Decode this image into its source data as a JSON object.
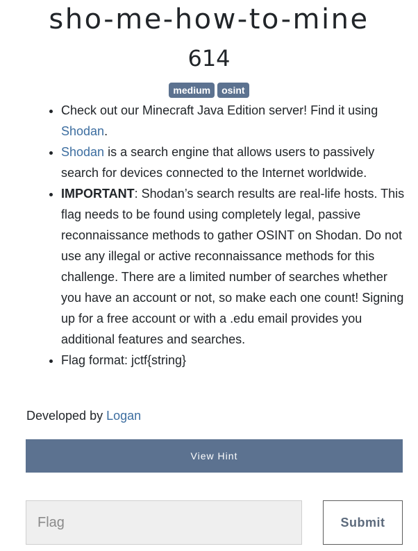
{
  "challenge": {
    "title": "sho-me-how-to-mine",
    "points": "614",
    "tags": [
      "medium",
      "osint"
    ]
  },
  "description": {
    "item1": {
      "text_before": "Check out our Minecraft Java Edition server! Find it using ",
      "link": "Shodan",
      "text_after": "."
    },
    "item2": {
      "link": "Shodan",
      "text_after": " is a search engine that allows users to passively search for devices connected to the Internet worldwide."
    },
    "item3": {
      "bold": "IMPORTANT",
      "text_after": ": Shodan’s search results are real-life hosts. This flag needs to be found using completely legal, passive reconnaissance methods to gather OSINT on Shodan. Do not use any illegal or active reconnaissance methods for this challenge. There are a limited number of searches whether you have an account or not, so make each one count! Signing up for a free account or with a .edu email provides you additional features and searches."
    },
    "item4": {
      "text": "Flag format: jctf{string}"
    }
  },
  "developer": {
    "prefix": "Developed by ",
    "name": "Logan"
  },
  "hint_button": {
    "label": "View Hint"
  },
  "flag_form": {
    "placeholder": "Flag",
    "submit_label": "Submit"
  },
  "colors": {
    "accent": "#5c7290",
    "link": "#3d6ea0"
  }
}
